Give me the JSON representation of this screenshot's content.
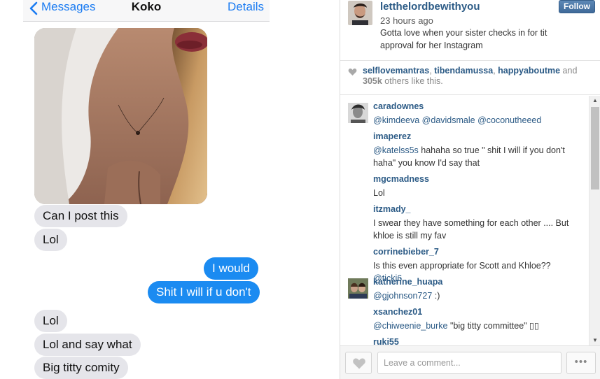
{
  "messages_screen": {
    "back_label": "Messages",
    "contact_name": "Koko",
    "details_label": "Details",
    "bubbles": [
      {
        "text": "Can I post this",
        "side": "received"
      },
      {
        "text": "Lol",
        "side": "received"
      },
      {
        "text": "I would",
        "side": "sent"
      },
      {
        "text": "Shit I will if u don't",
        "side": "sent"
      },
      {
        "text": "Lol",
        "side": "received"
      },
      {
        "text": "Lol and say what",
        "side": "received"
      },
      {
        "text": "Big titty comity",
        "side": "received"
      }
    ]
  },
  "post": {
    "owner": "letthelordbewithyou",
    "time": "23 hours ago",
    "caption": "Gotta love when your sister checks in for tit approval for her Instagram",
    "follow_label": "Follow",
    "likes": {
      "users": [
        "selflovemantras",
        "tibendamussa",
        "happyaboutme"
      ],
      "and_word": "and",
      "count": "305k",
      "tail": "others like this."
    },
    "comments": [
      {
        "user": "caradownes",
        "text": "@kimdeeva @davidsmale @coconutheeed"
      },
      {
        "user": "imaperez",
        "text": "@katelss5s hahaha so true \" shit I will if you don't haha\" you know I'd say that"
      },
      {
        "user": "mgcmadness",
        "text": "Lol"
      },
      {
        "user": "itzmady_",
        "text": "I swear they have something for each other .... But khloe is still my fav"
      },
      {
        "user": "corrinebieber_7",
        "text": "Is this even appropriate for Scott and Khloe?? @ticki6"
      },
      {
        "user": "katherine_huapa",
        "text": "@gjohnson727 :)"
      },
      {
        "user": "xsanchez01",
        "text": "@chiweenie_burke \"big titty committee\" ▯▯"
      },
      {
        "user": "ruki55",
        "text": ""
      }
    ],
    "comment_placeholder": "Leave a comment...",
    "more_label": "•••"
  },
  "colors": {
    "ios_blue": "#1b8bf1",
    "received_bubble": "#e5e5ea",
    "instagram_link": "#2c5b86"
  },
  "icons": [
    "back-chevron-icon",
    "heart-icon",
    "like-heart-icon"
  ]
}
